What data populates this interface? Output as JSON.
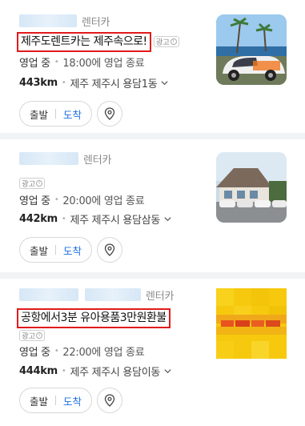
{
  "results": [
    {
      "category": "렌터카",
      "promo": "제주도렌트카는 제주속으로!",
      "ad_label": "광고",
      "status": "영업 중",
      "hours": "18:00에 영업 종료",
      "distance": "443km",
      "address": "제주 제주시 용담1동",
      "start_label": "출발",
      "arrive_label": "도착"
    },
    {
      "category": "렌터카",
      "ad_label": "광고",
      "status": "영업 중",
      "hours": "20:00에 영업 종료",
      "distance": "442km",
      "address": "제주 제주시 용담삼동",
      "start_label": "출발",
      "arrive_label": "도착"
    },
    {
      "category": "렌터카",
      "promo": "공항에서3분 유아용품3만원환불",
      "ad_label": "광고",
      "status": "영업 중",
      "hours": "22:00에 영업 종료",
      "distance": "444km",
      "address": "제주 제주시 용담이동",
      "start_label": "출발",
      "arrive_label": "도착"
    }
  ],
  "colors": {
    "highlight_border": "#e11b1b",
    "arrive_blue": "#1f6fe5",
    "divider": "#f1f3f5"
  },
  "icons": [
    "info-icon",
    "chevron-down-icon",
    "location-pin-icon"
  ]
}
